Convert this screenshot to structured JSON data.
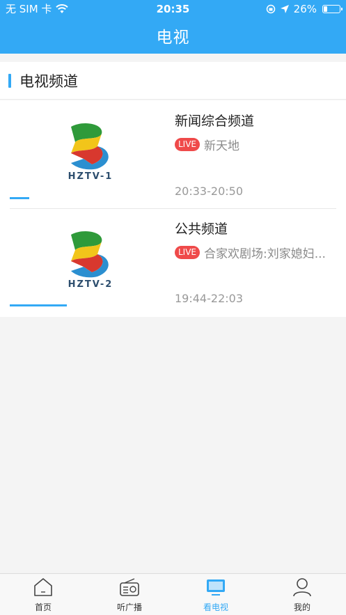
{
  "status_bar": {
    "carrier": "无 SIM 卡",
    "time": "20:35",
    "battery": "26%",
    "battery_level": 0.26
  },
  "header": {
    "title": "电视"
  },
  "section": {
    "title": "电视频道"
  },
  "channels": [
    {
      "logo_text": "HZTV-1",
      "name": "新闻综合频道",
      "live_label": "LIVE",
      "program": "新天地",
      "time": "20:33-20:50",
      "progress": 0.12
    },
    {
      "logo_text": "HZTV-2",
      "name": "公共频道",
      "live_label": "LIVE",
      "program": "合家欢剧场:刘家媳妇...",
      "time": "19:44-22:03",
      "progress": 0.35
    }
  ],
  "tabbar": {
    "tabs": [
      {
        "label": "首页",
        "icon": "home-icon"
      },
      {
        "label": "听广播",
        "icon": "radio-icon"
      },
      {
        "label": "看电视",
        "icon": "tv-icon",
        "active": true
      },
      {
        "label": "我的",
        "icon": "user-icon"
      }
    ]
  },
  "colors": {
    "accent": "#33a9f5",
    "live": "#ef4a4a"
  }
}
